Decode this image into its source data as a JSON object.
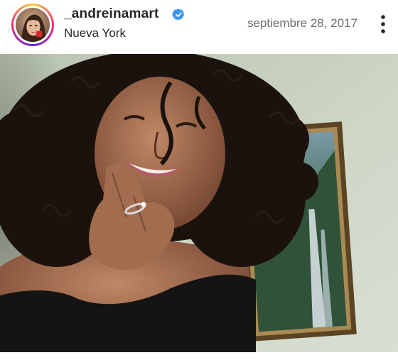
{
  "post": {
    "username": "_andreinamart",
    "verified": true,
    "location": "Nueva York",
    "date": "septiembre 28, 2017"
  },
  "icons": {
    "verified": "verified-badge-icon",
    "more": "more-options-icon"
  },
  "colors": {
    "verified_blue": "#3897f0",
    "story_ring_start": "#f9ce34",
    "story_ring_mid": "#ee2a7b",
    "story_ring_end": "#6228d7",
    "text_primary": "#262626",
    "text_secondary": "#6b6b6b"
  }
}
